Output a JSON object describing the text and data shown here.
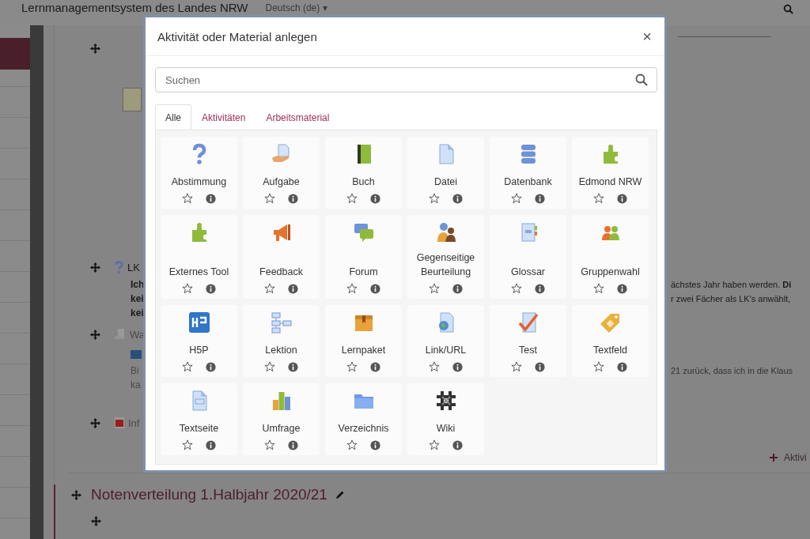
{
  "header": {
    "site_title": "Lernmanagementsystem des Landes NRW",
    "language": "Deutsch (de) ▾"
  },
  "course": {
    "lk_item": {
      "title": "LK",
      "lines": [
        {
          "left": "Ich",
          "right": "ächstes Jahr haben werden. **Di**"
        },
        {
          "left": "kei",
          "right": "r zwei Fächer als LK's anwählt,"
        },
        {
          "left": "kei"
        }
      ]
    },
    "wa_item": {
      "title": "Wa",
      "lines": [
        {
          "left": "Bi",
          "right": "21 zurück, dass ich in die Klaus"
        },
        {
          "left": "ka"
        }
      ]
    },
    "info_item": {
      "title": "Inf"
    },
    "add_link": "Aktivi",
    "next_section": "Notenverteilung 1.Halbjahr 2020/21"
  },
  "modal": {
    "title": "Aktivität oder Material anlegen",
    "close": "×",
    "search": {
      "placeholder": "Suchen"
    },
    "tabs": [
      {
        "label": "Alle",
        "selected": true
      },
      {
        "label": "Aktivitäten",
        "selected": false
      },
      {
        "label": "Arbeitsmaterial",
        "selected": false
      }
    ],
    "items": [
      {
        "label": "Abstimmung",
        "starred": false
      },
      {
        "label": "Aufgabe",
        "starred": false
      },
      {
        "label": "Buch",
        "starred": false
      },
      {
        "label": "Datei",
        "starred": false
      },
      {
        "label": "Datenbank",
        "starred": false
      },
      {
        "label": "Edmond NRW",
        "starred": false
      },
      {
        "label": "Externes Tool",
        "starred": false
      },
      {
        "label": "Feedback",
        "starred": false
      },
      {
        "label": "Forum",
        "starred": false
      },
      {
        "label": "Gegenseitige Beurteilung",
        "starred": false
      },
      {
        "label": "Glossar",
        "starred": false
      },
      {
        "label": "Gruppenwahl",
        "starred": false
      },
      {
        "label": "H5P",
        "starred": false
      },
      {
        "label": "Lektion",
        "starred": false
      },
      {
        "label": "Lernpaket",
        "starred": false
      },
      {
        "label": "Link/URL",
        "starred": false
      },
      {
        "label": "Test",
        "starred": false
      },
      {
        "label": "Textfeld",
        "starred": false
      },
      {
        "label": "Textseite",
        "starred": false
      },
      {
        "label": "Umfrage",
        "starred": false
      },
      {
        "label": "Verzeichnis",
        "starred": false
      },
      {
        "label": "Wiki",
        "starred": false
      }
    ]
  }
}
